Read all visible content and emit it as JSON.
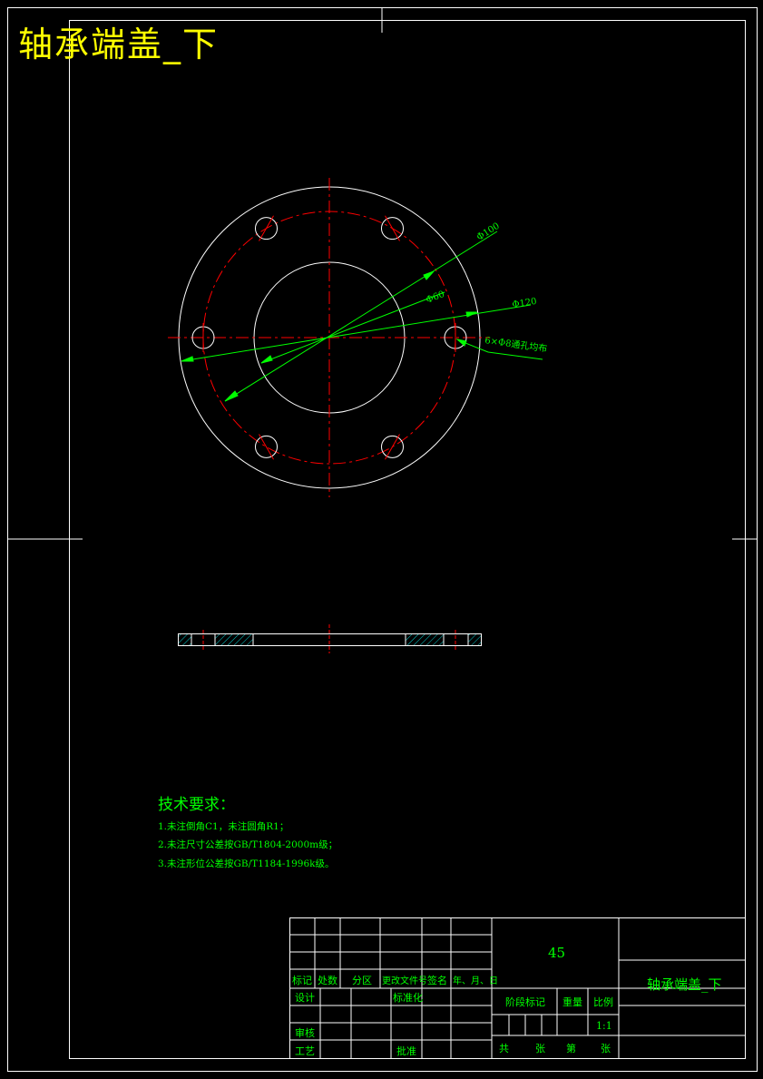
{
  "title": "轴承端盖_下",
  "dimensions": {
    "d100": "Φ100",
    "d60": "Φ60",
    "d120": "Φ120",
    "holes": "6×Φ8通孔均布"
  },
  "tech_requirements": {
    "heading": "技术要求：",
    "items": [
      "1.未注倒角C1，未注圆角R1；",
      "2.未注尺寸公差按GB/T1804-2000m级；",
      "3.未注形位公差按GB/T1184-1996k级。"
    ]
  },
  "title_block": {
    "material": "45",
    "part_name": "轴承端盖_下",
    "header_labels": [
      "标记",
      "处数",
      "分区",
      "更改文件号",
      "签名",
      "年、月、日"
    ],
    "design": "设计",
    "standardization": "标准化",
    "review": "审核",
    "process": "工艺",
    "approve": "批准",
    "stage_mark": "阶段标记",
    "weight": "重量",
    "scale_label": "比例",
    "scale_value": "1:1",
    "total": "共",
    "sheets": "张",
    "sheet_no": "第",
    "sheet_unit": "张"
  },
  "colors": {
    "background": "#000000",
    "outline": "#ffffff",
    "centerline": "#ff0000",
    "dimension": "#00ff00",
    "title": "#ffff00",
    "hatch": "#00ffff"
  }
}
